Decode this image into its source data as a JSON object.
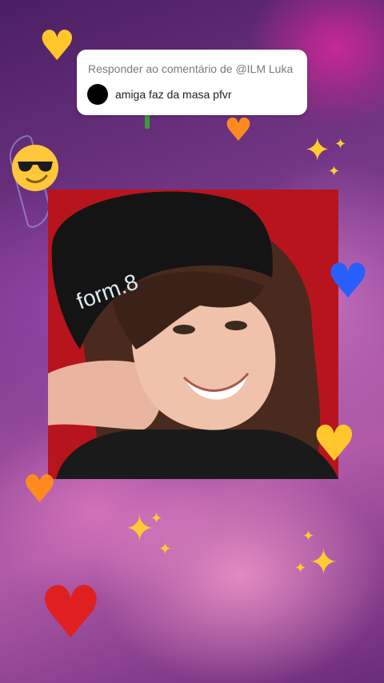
{
  "reply": {
    "title": "Responder ao comentário de @ILM Luka",
    "comment": "amiga faz da masa pfvr"
  },
  "icons": {
    "yellow_heart": "yellow-heart-icon",
    "orange_heart": "orange-heart-icon",
    "blue_heart": "blue-heart-icon",
    "red_heart": "red-heart-icon",
    "sparkles": "sparkles-icon",
    "sunglasses_face": "sunglasses-face-icon"
  },
  "photo": {
    "hat_text": "form.8"
  },
  "colors": {
    "photo_background": "#b8141d",
    "yellow": "#ffc72c",
    "orange": "#ff8a1f",
    "blue": "#2a5fff",
    "red": "#e02020"
  }
}
